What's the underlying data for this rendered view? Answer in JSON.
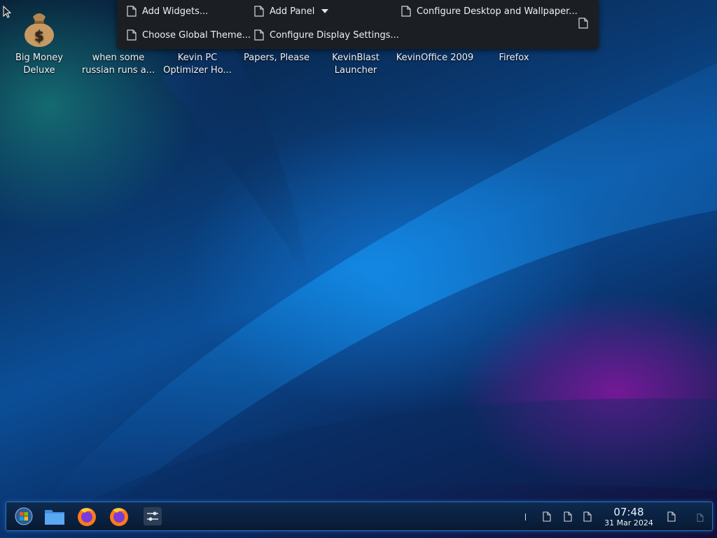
{
  "desktop": {
    "icons": [
      {
        "label": "Big Money Deluxe",
        "icon": "money-bag-icon"
      },
      {
        "label": "when some russian runs a...",
        "icon": "file-icon"
      },
      {
        "label": "Kevin PC Optimizer Ho...",
        "icon": "app-icon"
      },
      {
        "label": "Papers, Please",
        "icon": "app-icon"
      },
      {
        "label": "KevinBlast Launcher",
        "icon": "app-icon"
      },
      {
        "label": "KevinOffice 2009",
        "icon": "app-icon"
      },
      {
        "label": "Firefox",
        "icon": "firefox-icon"
      }
    ]
  },
  "toolbox": {
    "add_widgets": "Add Widgets...",
    "add_panel": "Add Panel",
    "configure_desktop": "Configure Desktop and Wallpaper...",
    "choose_theme": "Choose Global Theme...",
    "configure_display": "Configure Display Settings..."
  },
  "taskbar": {
    "launchers": [
      "start-menu-icon",
      "file-manager-icon",
      "firefox-icon",
      "firefox-icon",
      "settings-icon"
    ],
    "clock": {
      "time": "07:48",
      "date": "31 Mar 2024"
    }
  },
  "colors": {
    "accent": "#2f6fb1",
    "menu_bg": "#1b1e22"
  }
}
